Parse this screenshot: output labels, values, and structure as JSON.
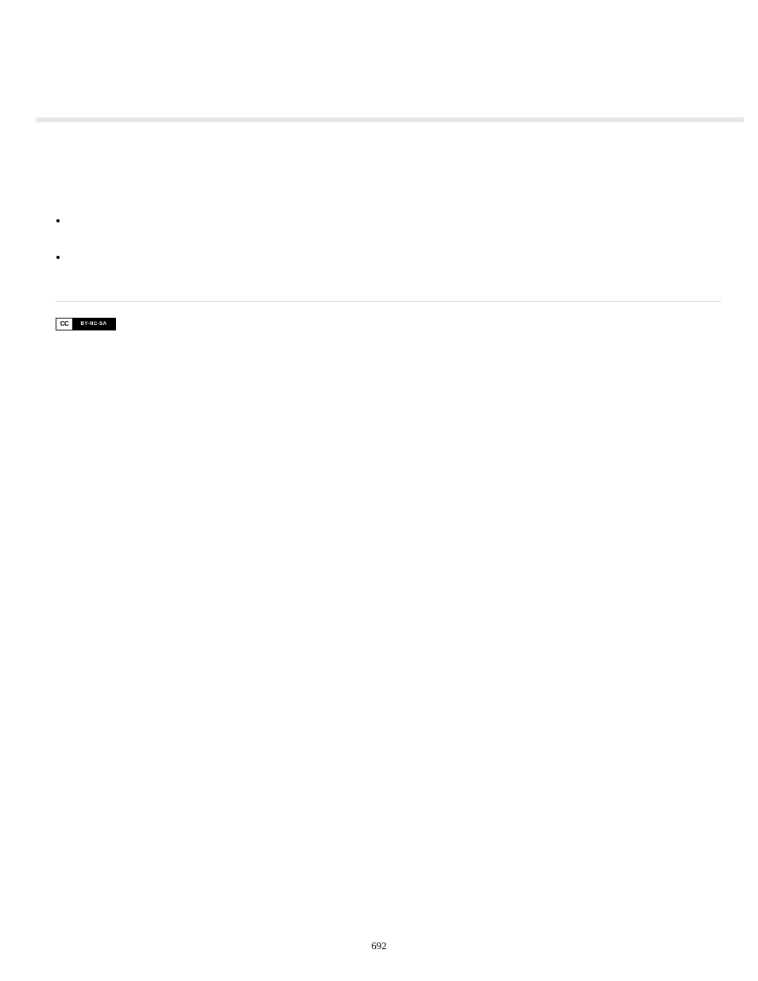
{
  "cc_badge": {
    "left": "CC",
    "right": "BY-NC-SA"
  },
  "page_number": "692"
}
